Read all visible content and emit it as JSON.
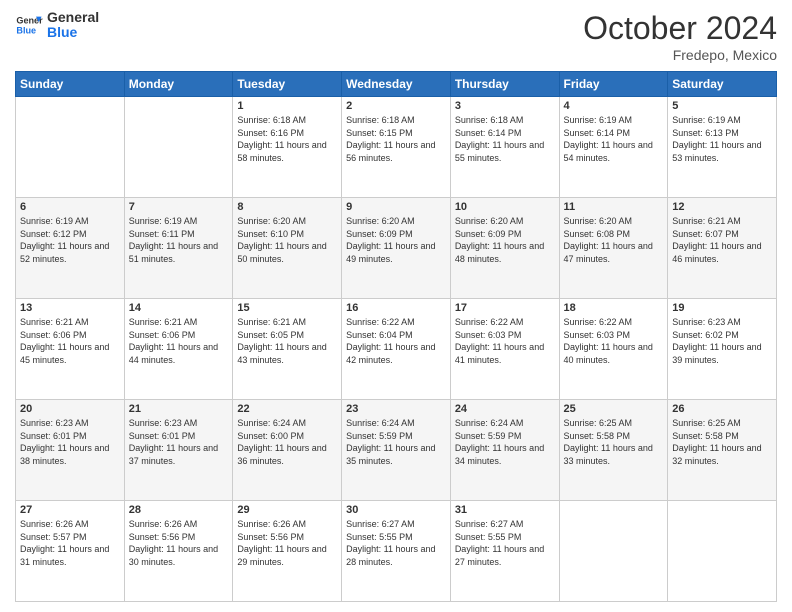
{
  "header": {
    "logo_line1": "General",
    "logo_line2": "Blue",
    "month": "October 2024",
    "location": "Fredepo, Mexico"
  },
  "days_of_week": [
    "Sunday",
    "Monday",
    "Tuesday",
    "Wednesday",
    "Thursday",
    "Friday",
    "Saturday"
  ],
  "weeks": [
    [
      {
        "day": "",
        "sunrise": "",
        "sunset": "",
        "daylight": ""
      },
      {
        "day": "",
        "sunrise": "",
        "sunset": "",
        "daylight": ""
      },
      {
        "day": "1",
        "sunrise": "Sunrise: 6:18 AM",
        "sunset": "Sunset: 6:16 PM",
        "daylight": "Daylight: 11 hours and 58 minutes."
      },
      {
        "day": "2",
        "sunrise": "Sunrise: 6:18 AM",
        "sunset": "Sunset: 6:15 PM",
        "daylight": "Daylight: 11 hours and 56 minutes."
      },
      {
        "day": "3",
        "sunrise": "Sunrise: 6:18 AM",
        "sunset": "Sunset: 6:14 PM",
        "daylight": "Daylight: 11 hours and 55 minutes."
      },
      {
        "day": "4",
        "sunrise": "Sunrise: 6:19 AM",
        "sunset": "Sunset: 6:14 PM",
        "daylight": "Daylight: 11 hours and 54 minutes."
      },
      {
        "day": "5",
        "sunrise": "Sunrise: 6:19 AM",
        "sunset": "Sunset: 6:13 PM",
        "daylight": "Daylight: 11 hours and 53 minutes."
      }
    ],
    [
      {
        "day": "6",
        "sunrise": "Sunrise: 6:19 AM",
        "sunset": "Sunset: 6:12 PM",
        "daylight": "Daylight: 11 hours and 52 minutes."
      },
      {
        "day": "7",
        "sunrise": "Sunrise: 6:19 AM",
        "sunset": "Sunset: 6:11 PM",
        "daylight": "Daylight: 11 hours and 51 minutes."
      },
      {
        "day": "8",
        "sunrise": "Sunrise: 6:20 AM",
        "sunset": "Sunset: 6:10 PM",
        "daylight": "Daylight: 11 hours and 50 minutes."
      },
      {
        "day": "9",
        "sunrise": "Sunrise: 6:20 AM",
        "sunset": "Sunset: 6:09 PM",
        "daylight": "Daylight: 11 hours and 49 minutes."
      },
      {
        "day": "10",
        "sunrise": "Sunrise: 6:20 AM",
        "sunset": "Sunset: 6:09 PM",
        "daylight": "Daylight: 11 hours and 48 minutes."
      },
      {
        "day": "11",
        "sunrise": "Sunrise: 6:20 AM",
        "sunset": "Sunset: 6:08 PM",
        "daylight": "Daylight: 11 hours and 47 minutes."
      },
      {
        "day": "12",
        "sunrise": "Sunrise: 6:21 AM",
        "sunset": "Sunset: 6:07 PM",
        "daylight": "Daylight: 11 hours and 46 minutes."
      }
    ],
    [
      {
        "day": "13",
        "sunrise": "Sunrise: 6:21 AM",
        "sunset": "Sunset: 6:06 PM",
        "daylight": "Daylight: 11 hours and 45 minutes."
      },
      {
        "day": "14",
        "sunrise": "Sunrise: 6:21 AM",
        "sunset": "Sunset: 6:06 PM",
        "daylight": "Daylight: 11 hours and 44 minutes."
      },
      {
        "day": "15",
        "sunrise": "Sunrise: 6:21 AM",
        "sunset": "Sunset: 6:05 PM",
        "daylight": "Daylight: 11 hours and 43 minutes."
      },
      {
        "day": "16",
        "sunrise": "Sunrise: 6:22 AM",
        "sunset": "Sunset: 6:04 PM",
        "daylight": "Daylight: 11 hours and 42 minutes."
      },
      {
        "day": "17",
        "sunrise": "Sunrise: 6:22 AM",
        "sunset": "Sunset: 6:03 PM",
        "daylight": "Daylight: 11 hours and 41 minutes."
      },
      {
        "day": "18",
        "sunrise": "Sunrise: 6:22 AM",
        "sunset": "Sunset: 6:03 PM",
        "daylight": "Daylight: 11 hours and 40 minutes."
      },
      {
        "day": "19",
        "sunrise": "Sunrise: 6:23 AM",
        "sunset": "Sunset: 6:02 PM",
        "daylight": "Daylight: 11 hours and 39 minutes."
      }
    ],
    [
      {
        "day": "20",
        "sunrise": "Sunrise: 6:23 AM",
        "sunset": "Sunset: 6:01 PM",
        "daylight": "Daylight: 11 hours and 38 minutes."
      },
      {
        "day": "21",
        "sunrise": "Sunrise: 6:23 AM",
        "sunset": "Sunset: 6:01 PM",
        "daylight": "Daylight: 11 hours and 37 minutes."
      },
      {
        "day": "22",
        "sunrise": "Sunrise: 6:24 AM",
        "sunset": "Sunset: 6:00 PM",
        "daylight": "Daylight: 11 hours and 36 minutes."
      },
      {
        "day": "23",
        "sunrise": "Sunrise: 6:24 AM",
        "sunset": "Sunset: 5:59 PM",
        "daylight": "Daylight: 11 hours and 35 minutes."
      },
      {
        "day": "24",
        "sunrise": "Sunrise: 6:24 AM",
        "sunset": "Sunset: 5:59 PM",
        "daylight": "Daylight: 11 hours and 34 minutes."
      },
      {
        "day": "25",
        "sunrise": "Sunrise: 6:25 AM",
        "sunset": "Sunset: 5:58 PM",
        "daylight": "Daylight: 11 hours and 33 minutes."
      },
      {
        "day": "26",
        "sunrise": "Sunrise: 6:25 AM",
        "sunset": "Sunset: 5:58 PM",
        "daylight": "Daylight: 11 hours and 32 minutes."
      }
    ],
    [
      {
        "day": "27",
        "sunrise": "Sunrise: 6:26 AM",
        "sunset": "Sunset: 5:57 PM",
        "daylight": "Daylight: 11 hours and 31 minutes."
      },
      {
        "day": "28",
        "sunrise": "Sunrise: 6:26 AM",
        "sunset": "Sunset: 5:56 PM",
        "daylight": "Daylight: 11 hours and 30 minutes."
      },
      {
        "day": "29",
        "sunrise": "Sunrise: 6:26 AM",
        "sunset": "Sunset: 5:56 PM",
        "daylight": "Daylight: 11 hours and 29 minutes."
      },
      {
        "day": "30",
        "sunrise": "Sunrise: 6:27 AM",
        "sunset": "Sunset: 5:55 PM",
        "daylight": "Daylight: 11 hours and 28 minutes."
      },
      {
        "day": "31",
        "sunrise": "Sunrise: 6:27 AM",
        "sunset": "Sunset: 5:55 PM",
        "daylight": "Daylight: 11 hours and 27 minutes."
      },
      {
        "day": "",
        "sunrise": "",
        "sunset": "",
        "daylight": ""
      },
      {
        "day": "",
        "sunrise": "",
        "sunset": "",
        "daylight": ""
      }
    ]
  ]
}
